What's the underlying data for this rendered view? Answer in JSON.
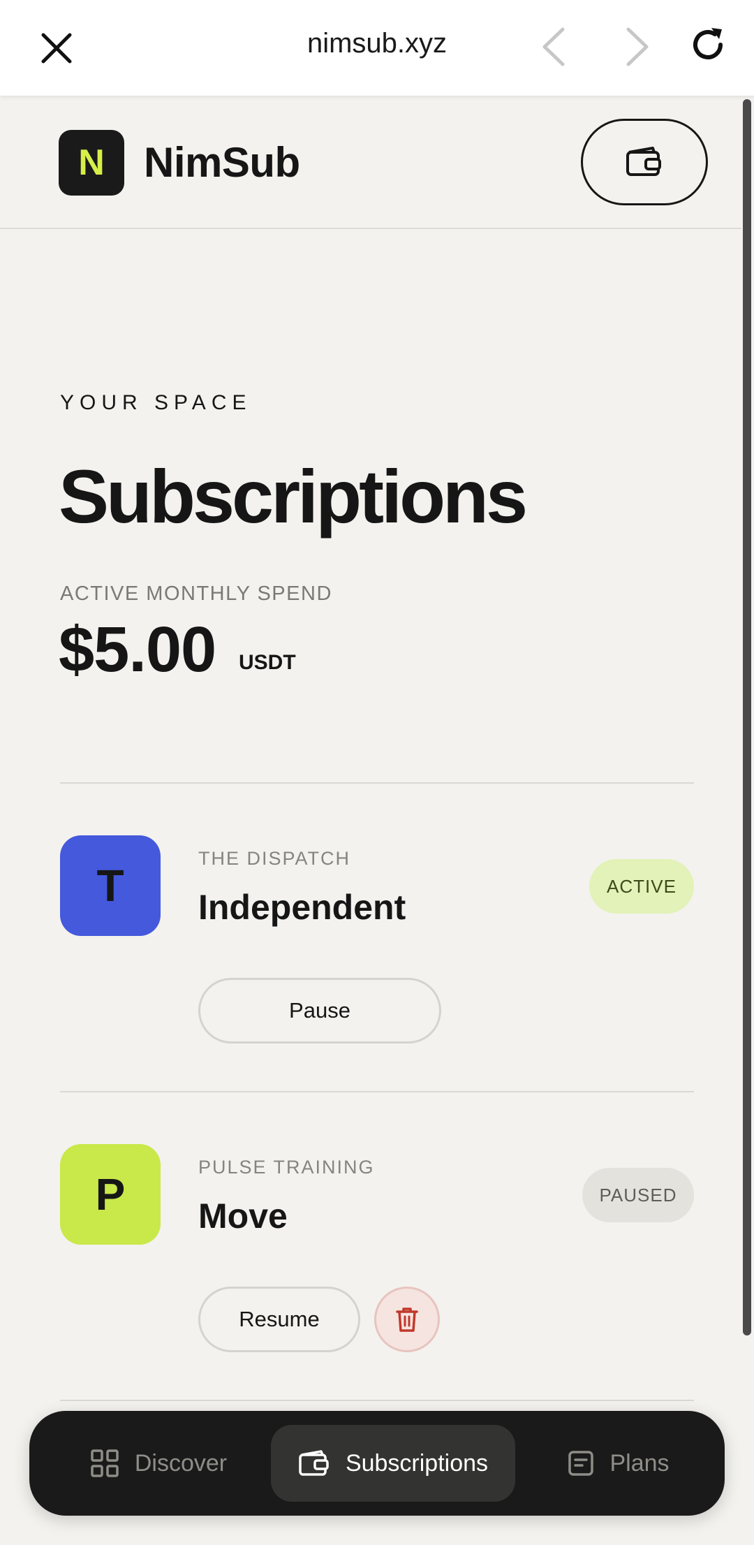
{
  "browser": {
    "url": "nimsub.xyz",
    "close_icon": "close-icon",
    "back_icon": "chevron-left-icon",
    "forward_icon": "chevron-right-icon",
    "reload_icon": "reload-icon"
  },
  "header": {
    "logo_letter": "N",
    "brand": "NimSub",
    "wallet_icon": "wallet-icon"
  },
  "hero": {
    "eyebrow": "YOUR SPACE",
    "title": "Subscriptions",
    "spend_label": "ACTIVE MONTHLY SPEND",
    "spend_amount": "$5.00",
    "spend_unit": "USDT"
  },
  "subscriptions": [
    {
      "avatar_letter": "T",
      "avatar_color": "#4459dc",
      "publisher": "THE DISPATCH",
      "name": "Independent",
      "status": "ACTIVE",
      "status_bg": "#e2f2b8",
      "status_color": "#3d4a1a",
      "action": "Pause"
    },
    {
      "avatar_letter": "P",
      "avatar_color": "#c9e84a",
      "publisher": "PULSE TRAINING",
      "name": "Move",
      "status": "PAUSED",
      "status_bg": "#e3e2dd",
      "status_color": "#5e5d58",
      "action": "Resume",
      "delete_icon": "trash-icon"
    }
  ],
  "nav": {
    "items": [
      {
        "label": "Discover",
        "icon": "grid-icon",
        "active": false
      },
      {
        "label": "Subscriptions",
        "icon": "wallet-icon",
        "active": true
      },
      {
        "label": "Plans",
        "icon": "document-icon",
        "active": false
      }
    ]
  },
  "colors": {
    "background": "#f3f2ee",
    "dark": "#1a1a1a",
    "accent_lime": "#d7ee4a",
    "danger": "#c0392b"
  }
}
